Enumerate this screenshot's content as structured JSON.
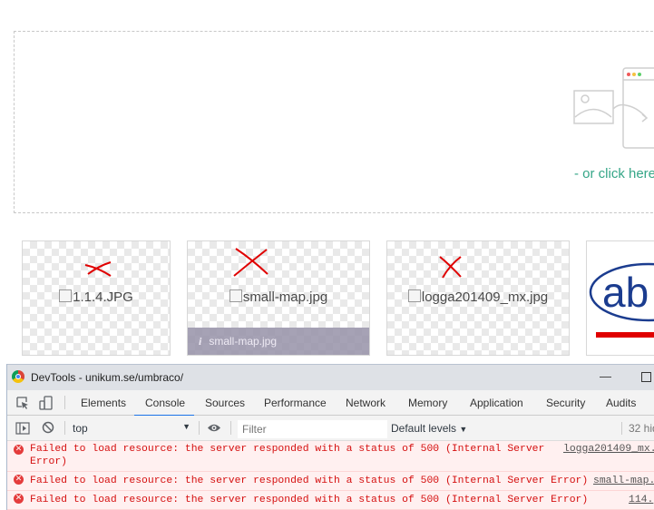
{
  "upload": {
    "click_here": "- or click here"
  },
  "thumbnails": [
    {
      "alt": "1.1.4.JPG"
    },
    {
      "alt": "small-map.jpg",
      "caption": "small-map.jpg"
    },
    {
      "alt": "logga201409_mx.jpg"
    },
    {
      "logo_text": "ab"
    }
  ],
  "devtools": {
    "title": "DevTools - unikum.se/umbraco/",
    "tabs": [
      "Elements",
      "Console",
      "Sources",
      "Performance",
      "Network",
      "Memory",
      "Application",
      "Security",
      "Audits"
    ],
    "active_tab": "Console",
    "context": "top",
    "filter_placeholder": "Filter",
    "levels": "Default levels",
    "hidden_count": "32 hid",
    "messages": [
      {
        "line1": "Failed to load resource: the server responded with a status of 500 (Internal Server",
        "line2": "Error)",
        "source": "logga201409_mx."
      },
      {
        "line1": "Failed to load resource: the server responded with a status of 500 (Internal Server Error)",
        "source": "small-map."
      },
      {
        "line1": "Failed to load resource: the server responded with a status of 500 (Internal Server Error)",
        "source": "114."
      }
    ]
  },
  "colors": {
    "accent_link": "#35a687",
    "error_text": "#d50f0f",
    "error_bg": "#fff0f0",
    "tab_underline": "#1a73e8",
    "annotation_red": "#e00000"
  }
}
